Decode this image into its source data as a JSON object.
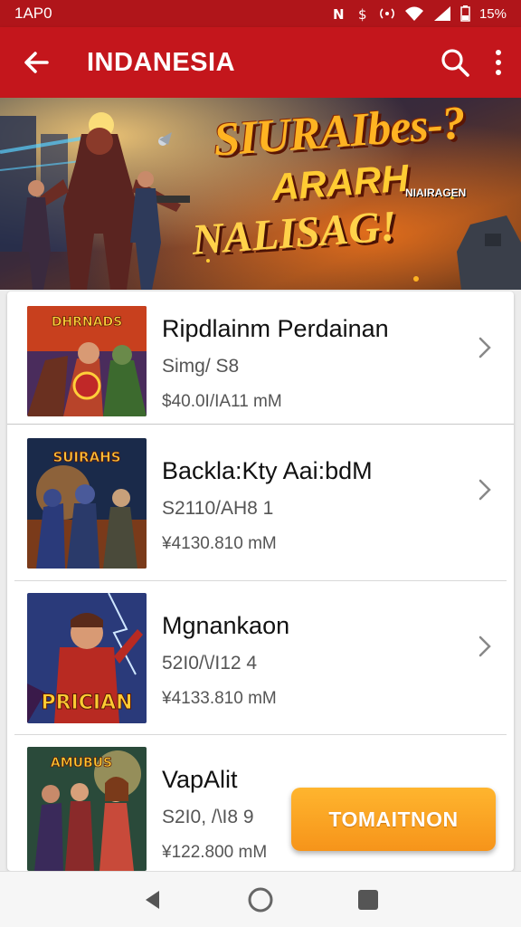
{
  "status_bar": {
    "time": "1AP0",
    "battery": "15%"
  },
  "app_bar": {
    "title": "INDANESIA"
  },
  "banner": {
    "line1": "SIURAIbes-?",
    "line2": "ARARH",
    "small": "NIAIRAGEN",
    "line3": "NALISAG!"
  },
  "items": [
    {
      "title": "Ripdlainm Perdainan",
      "subtitle": "Simg/ S8",
      "price": "$40.0I/IA11  mM",
      "thumb_text": "DHRNADS"
    },
    {
      "title": "Backla:Kty Aai:bdM",
      "subtitle": "S2110/AH8   1",
      "price": "¥4130.810  mM",
      "thumb_text": "SUIRAHS"
    },
    {
      "title": "Mgnankaon",
      "subtitle": "52I0/\\/I12   4",
      "price": "¥4133.810  mM",
      "thumb_text": "PRICIAN"
    },
    {
      "title": "VapAlit",
      "subtitle": "S2I0, /\\I8   9",
      "price": "¥122.800  mM",
      "thumb_text": "AMUBUS"
    }
  ],
  "fab": {
    "label": "TOMAITNON"
  },
  "colors": {
    "primary": "#c4161c",
    "accent": "#f6941a"
  }
}
